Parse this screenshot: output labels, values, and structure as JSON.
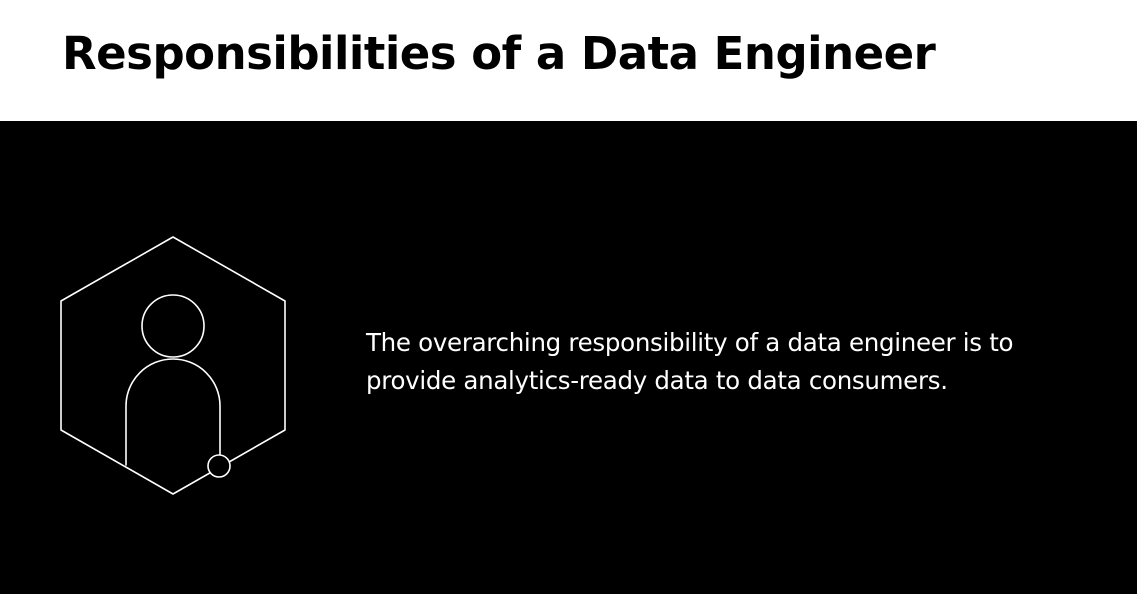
{
  "slide": {
    "title": "Responsibilities of a Data Engineer",
    "body": "The overarching responsibility of a data engineer is to\nprovide analytics-ready data to data consumers.",
    "icon": "person-in-hexagon-icon",
    "colors": {
      "header_background": "#ffffff",
      "panel_background": "#000000",
      "title_text": "#000000",
      "body_text": "#ffffff",
      "icon_stroke": "#ffffff"
    }
  }
}
